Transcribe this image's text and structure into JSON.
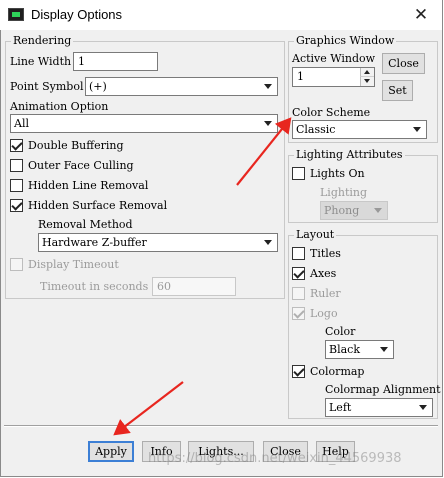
{
  "window": {
    "title": "Display Options",
    "close_glyph": "✕",
    "icon": "app-icon"
  },
  "rendering": {
    "title": "Rendering",
    "line_width_label": "Line Width",
    "line_width_value": "1",
    "point_symbol_label": "Point Symbol",
    "point_symbol_value": "(+)",
    "animation_label": "Animation Option",
    "animation_value": "All",
    "double_buffering": "Double Buffering",
    "outer_face_culling": "Outer Face Culling",
    "hidden_line_removal": "Hidden Line Removal",
    "hidden_surface_removal": "Hidden Surface Removal",
    "removal_method_label": "Removal Method",
    "removal_method_value": "Hardware Z-buffer",
    "display_timeout": "Display Timeout",
    "timeout_label": "Timeout in seconds",
    "timeout_value": "60"
  },
  "graphics_window": {
    "title": "Graphics Window",
    "active_window_label": "Active Window",
    "active_window_value": "1",
    "close_label": "Close",
    "set_label": "Set",
    "color_scheme_label": "Color Scheme",
    "color_scheme_value": "Classic"
  },
  "lighting": {
    "title": "Lighting Attributes",
    "lights_on": "Lights On",
    "lighting_label": "Lighting",
    "lighting_value": "Phong"
  },
  "layout": {
    "title": "Layout",
    "titles": "Titles",
    "axes": "Axes",
    "ruler": "Ruler",
    "logo": "Logo",
    "color_label": "Color",
    "color_value": "Black",
    "colormap": "Colormap",
    "colormap_alignment_label": "Colormap Alignment",
    "colormap_alignment_value": "Left"
  },
  "buttons": {
    "apply": "Apply",
    "info": "Info",
    "lights": "Lights...",
    "close": "Close",
    "help": "Help"
  },
  "watermark": "https://blog.csdn.net/weixin_44569938",
  "checks": {
    "double_buffering": true,
    "outer_face_culling": false,
    "hidden_line_removal": false,
    "hidden_surface_removal": true,
    "display_timeout": false,
    "lights_on": false,
    "titles": false,
    "axes": true,
    "ruler": false,
    "logo": true,
    "colormap": true
  },
  "colors": {
    "annotation_arrow": "#e8261f",
    "default_button_border": "#3c7fd5"
  }
}
